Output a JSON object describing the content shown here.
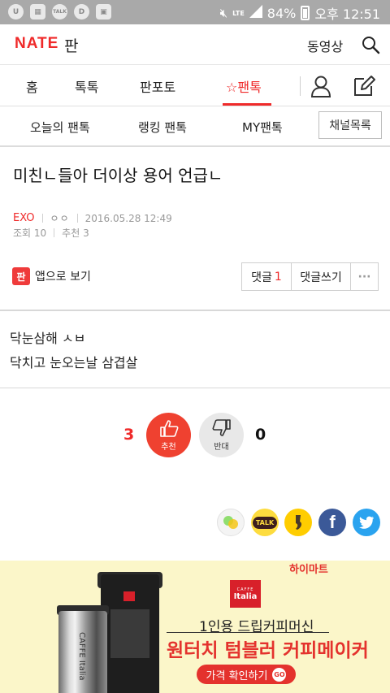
{
  "status_bar": {
    "icons": [
      "u-app-icon",
      "photo-icon",
      "talk-icon",
      "d-app-icon",
      "gallery-icon"
    ],
    "icon_labels": {
      "talk": "TALK",
      "d": "D"
    },
    "lte": "LTE",
    "battery": "84%",
    "time": "오후 12:51"
  },
  "header": {
    "logo": "NATE",
    "section": "판",
    "video": "동영상"
  },
  "main_nav": {
    "items": [
      "홈",
      "톡톡",
      "판포토",
      "☆팬톡"
    ],
    "active_index": 3
  },
  "sub_nav": {
    "items": [
      "오늘의 팬톡",
      "랭킹 팬톡",
      "MY팬톡"
    ],
    "channel_list": "채널목록"
  },
  "post": {
    "title": "미친ㄴ들아 더이상 용어 언급ㄴ",
    "channel": "EXO",
    "author": "ㅇㅇ",
    "date": "2016.05.28 12:49",
    "views": "조회 10",
    "recommends": "추천 3",
    "app_view": "앱으로 보기",
    "app_icon_char": "판",
    "comments_label": "댓글",
    "comments_count": "1",
    "write_comment": "댓글쓰기",
    "more": "···",
    "body": [
      "닥눈삼해 ㅅㅂ",
      "닥치고 눈오는날 삼겹살"
    ]
  },
  "vote": {
    "up_count": "3",
    "up_label": "추천",
    "down_label": "반대",
    "down_count": "0"
  },
  "share": {
    "buttons": [
      "band-icon",
      "kakaotalk-icon",
      "kakaostory-icon",
      "facebook-icon",
      "twitter-icon"
    ],
    "kakaotalk_label": "TALK",
    "colors": {
      "band": "#f4f4f4",
      "kakaotalk": "#fddc3f",
      "kakaostory": "#ffcd00",
      "facebook": "#3b5998",
      "twitter": "#2aa3ef"
    }
  },
  "ad": {
    "brand": "하이마트",
    "logo_small": "CAFFE",
    "logo_big": "Italia",
    "product_text": "CAFFE Italia",
    "line1": "1인용 드립커피머신",
    "line2": "원터치 텀블러 커피메이커",
    "cta": "가격 확인하기",
    "cta_go": "GO"
  },
  "colors": {
    "accent": "#ef2a2a",
    "status_bar": "#a9a9a9",
    "ad_bg": "#fbf6c9"
  }
}
